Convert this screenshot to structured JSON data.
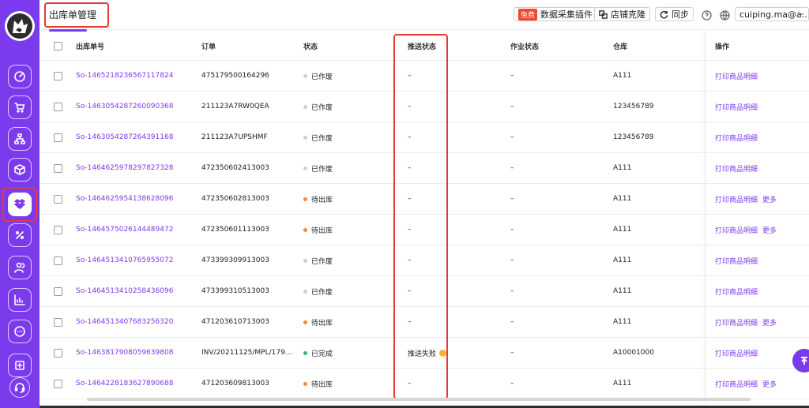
{
  "header": {
    "title": "出库单管理",
    "free_badge": "免费",
    "plugin_label": "数据采集插件",
    "clone_label": "店铺克隆",
    "sync_label": "同步",
    "user": "cuiping.ma@a..."
  },
  "table": {
    "columns": [
      "出库单号",
      "订单",
      "状态",
      "推送状态",
      "作业状态",
      "仓库",
      "操作"
    ],
    "rows": [
      {
        "id": "So-1465218236567117824",
        "order": "475179500164296",
        "status": "已作废",
        "status_color": "#cfcfcf",
        "push": "–",
        "job": "–",
        "warehouse": "A111",
        "op1": "打印商品明细",
        "op2": ""
      },
      {
        "id": "So-1463054287260090368",
        "order": "211123A7RW0QEA",
        "status": "已作废",
        "status_color": "#cfcfcf",
        "push": "–",
        "job": "–",
        "warehouse": "123456789",
        "op1": "打印商品明细",
        "op2": ""
      },
      {
        "id": "So-1463054287264391168",
        "order": "211123A7UPSHMF",
        "status": "已作废",
        "status_color": "#cfcfcf",
        "push": "–",
        "job": "–",
        "warehouse": "123456789",
        "op1": "打印商品明细",
        "op2": ""
      },
      {
        "id": "So-1464625978297827328",
        "order": "472350602413003",
        "status": "已作废",
        "status_color": "#cfcfcf",
        "push": "–",
        "job": "–",
        "warehouse": "A111",
        "op1": "打印商品明细",
        "op2": ""
      },
      {
        "id": "So-1464625954138628096",
        "order": "472350602813003",
        "status": "待出库",
        "status_color": "#f5873a",
        "push": "–",
        "job": "–",
        "warehouse": "A111",
        "op1": "打印商品明细",
        "op2": "更多"
      },
      {
        "id": "So-1464575026144489472",
        "order": "472350601113003",
        "status": "待出库",
        "status_color": "#f5873a",
        "push": "–",
        "job": "–",
        "warehouse": "A111",
        "op1": "打印商品明细",
        "op2": "更多"
      },
      {
        "id": "So-1464513410765955072",
        "order": "473399309913003",
        "status": "已作废",
        "status_color": "#cfcfcf",
        "push": "–",
        "job": "–",
        "warehouse": "A111",
        "op1": "打印商品明细",
        "op2": ""
      },
      {
        "id": "So-1464513410258436096",
        "order": "473399310513003",
        "status": "已作废",
        "status_color": "#cfcfcf",
        "push": "–",
        "job": "–",
        "warehouse": "A111",
        "op1": "打印商品明细",
        "op2": ""
      },
      {
        "id": "So-1464513407683256320",
        "order": "471203610713003",
        "status": "待出库",
        "status_color": "#f5873a",
        "push": "–",
        "job": "–",
        "warehouse": "A111",
        "op1": "打印商品明细",
        "op2": "更多"
      },
      {
        "id": "So-1463817908059639808",
        "order": "INV/20211125/MPL/179...",
        "status": "已完成",
        "status_color": "#3bb56a",
        "push": "推送失败",
        "job": "–",
        "warehouse": "A10001000",
        "op1": "打印商品明细",
        "op2": ""
      },
      {
        "id": "So-1464228183627890688",
        "order": "471203609813003",
        "status": "待出库",
        "status_color": "#f5873a",
        "push": "–",
        "job": "–",
        "warehouse": "A111",
        "op1": "打印商品明细",
        "op2": "更多"
      }
    ]
  },
  "colors": {
    "accent": "#7c3aed",
    "highlight": "#e53935"
  },
  "sidebar": {
    "icons": [
      "dashboard-icon",
      "cart-icon",
      "org-chart-icon",
      "box-icon",
      "dropbox-icon",
      "percent-icon",
      "users-icon",
      "bar-chart-icon",
      "chat-icon",
      "plus-square-icon",
      "headset-icon"
    ]
  }
}
